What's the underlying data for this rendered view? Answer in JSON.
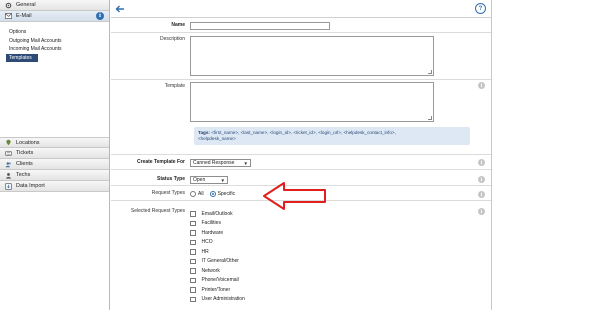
{
  "nav": {
    "top_items": [
      {
        "label": "General",
        "icon": "gear-icon"
      },
      {
        "label": "E-Mail",
        "icon": "envelope-icon"
      }
    ],
    "email_sub_items": [
      "Options",
      "Outgoing Mail Accounts",
      "Incoming Mail Accounts",
      "Templates"
    ],
    "selected_sub_item": "Templates",
    "bottom_items": [
      {
        "label": "Locations",
        "icon": "location-icon"
      },
      {
        "label": "Tickets",
        "icon": "ticket-icon"
      },
      {
        "label": "Clients",
        "icon": "clients-icon"
      },
      {
        "label": "Techs",
        "icon": "techs-icon"
      },
      {
        "label": "Data Import",
        "icon": "data-import-icon"
      }
    ]
  },
  "form": {
    "name_label": "Name",
    "name_value": "",
    "description_label": "Description",
    "template_label": "Template",
    "tags_prefix": "Tags:",
    "tags_line1": "<first_name>, <last_name>, <login_id>, <ticket_id>, <login_url>, <helpdesk_contact_info>,",
    "tags_line2": "<helpdesk_name>",
    "create_for_label": "Create Template For",
    "create_for_value": "Canned Response",
    "status_type_label": "Status Type",
    "status_type_value": "Open",
    "request_types_label": "Request Types",
    "request_types_options": [
      "All",
      "Specific"
    ],
    "request_types_selected": "Specific",
    "selected_request_types_label": "Selected Request Types",
    "request_type_list": [
      "Email/Outlook",
      "Facilities",
      "Hardware",
      "HCO",
      "HR",
      "IT General/Other",
      "Network",
      "Phone/Voicemail",
      "Printer/Toner",
      "User Administration"
    ]
  },
  "icons": {
    "back": "back-arrow-icon",
    "help": "?",
    "info": "i"
  },
  "colors": {
    "accent": "#2f6fb1",
    "selected_nav": "#2e4b78",
    "tags_bg": "#dde8f4",
    "annotation_arrow": "#e02020"
  }
}
